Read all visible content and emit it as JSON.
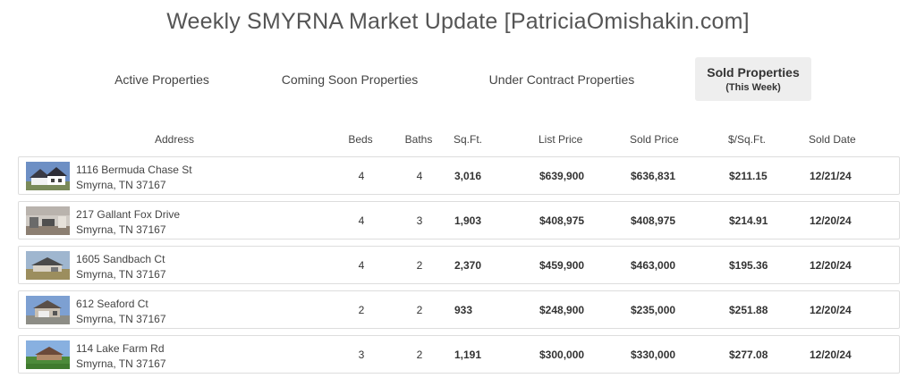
{
  "page": {
    "title": "Weekly SMYRNA Market Update [PatriciaOmishakin.com]"
  },
  "tabs": [
    {
      "label": "Active Properties",
      "sub": ""
    },
    {
      "label": "Coming Soon Properties",
      "sub": ""
    },
    {
      "label": "Under Contract Properties",
      "sub": ""
    },
    {
      "label": "Sold Properties",
      "sub": "(This Week)"
    }
  ],
  "active_tab_index": 3,
  "table": {
    "columns": [
      "Address",
      "Beds",
      "Baths",
      "Sq.Ft.",
      "List Price",
      "Sold Price",
      "$/Sq.Ft.",
      "Sold Date"
    ],
    "rows": [
      {
        "street": "1116 Bermuda Chase St",
        "city": "Smyrna, TN 37167",
        "beds": "4",
        "baths": "4",
        "sqft": "3,016",
        "list_price": "$639,900",
        "sold_price": "$636,831",
        "price_per_sqft": "$211.15",
        "sold_date": "12/21/24",
        "thumb": "house-photo-white-exterior"
      },
      {
        "street": "217 Gallant Fox Drive",
        "city": "Smyrna, TN 37167",
        "beds": "4",
        "baths": "3",
        "sqft": "1,903",
        "list_price": "$408,975",
        "sold_price": "$408,975",
        "price_per_sqft": "$214.91",
        "sold_date": "12/20/24",
        "thumb": "house-photo-interior"
      },
      {
        "street": "1605 Sandbach Ct",
        "city": "Smyrna, TN 37167",
        "beds": "4",
        "baths": "2",
        "sqft": "2,370",
        "list_price": "$459,900",
        "sold_price": "$463,000",
        "price_per_sqft": "$195.36",
        "sold_date": "12/20/24",
        "thumb": "house-photo-lawn"
      },
      {
        "street": "612 Seaford Ct",
        "city": "Smyrna, TN 37167",
        "beds": "2",
        "baths": "2",
        "sqft": "933",
        "list_price": "$248,900",
        "sold_price": "$235,000",
        "price_per_sqft": "$251.88",
        "sold_date": "12/20/24",
        "thumb": "house-photo-garage"
      },
      {
        "street": "114 Lake Farm Rd",
        "city": "Smyrna, TN 37167",
        "beds": "3",
        "baths": "2",
        "sqft": "1,191",
        "list_price": "$300,000",
        "sold_price": "$330,000",
        "price_per_sqft": "$277.08",
        "sold_date": "12/20/24",
        "thumb": "house-photo-lawn-green"
      }
    ]
  },
  "colors": {
    "title": "#555555",
    "tab_active_bg": "#eeeeee",
    "row_border": "#dddddd",
    "text": "#333333"
  }
}
